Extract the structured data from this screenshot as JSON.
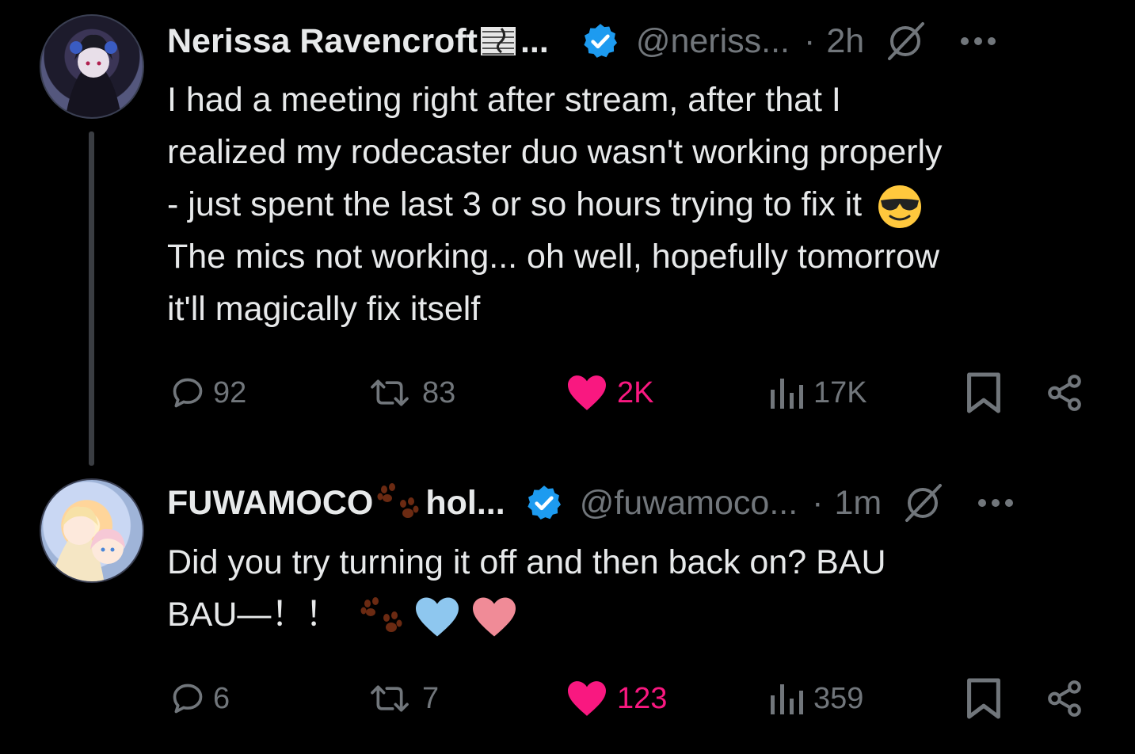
{
  "tweets": [
    {
      "display_name": "Nerissa Ravencroft",
      "name_emoji": "music-score-emoji",
      "name_truncation": "...",
      "handle": "@neriss...",
      "time": "2h",
      "separator": "·",
      "verified": true,
      "body_lines": [
        "I had a meeting right after stream, after that I",
        "realized my rodecaster duo wasn't working properly",
        "- just spent the last 3 or so hours trying to fix it",
        "The mics not working... oh well, hopefully tomorrow",
        "it'll magically fix itself"
      ],
      "body_emoji": "sunglasses-face-emoji",
      "stats": {
        "replies": "92",
        "reposts": "83",
        "likes": "2K",
        "views": "17K"
      },
      "liked": true
    },
    {
      "display_name": "FUWAMOCO",
      "name_emoji": "paw-prints-emoji",
      "name_suffix": "hol...",
      "handle": "@fuwamoco...",
      "time": "1m",
      "separator": "·",
      "verified": true,
      "body_lines": [
        "Did you try turning it off and then back on? BAU",
        "BAU—！！"
      ],
      "body_emojis": [
        "paw-prints-emoji",
        "blue-heart-emoji",
        "pink-heart-emoji"
      ],
      "stats": {
        "replies": "6",
        "reposts": "7",
        "likes": "123",
        "views": "359"
      },
      "liked": true
    }
  ],
  "colors": {
    "background": "#000000",
    "text": "#e7e9ea",
    "muted": "#71767b",
    "like": "#f91880",
    "verified": "#1d9bf0"
  }
}
